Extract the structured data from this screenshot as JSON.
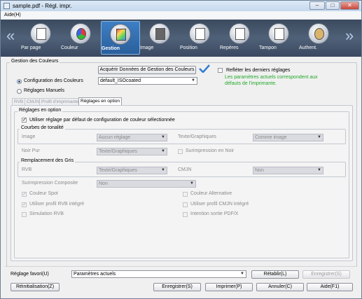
{
  "window": {
    "title": "sample.pdf - Régl. impr.",
    "buttons": {
      "minimize": "–",
      "maximize": "□",
      "close": "✕"
    }
  },
  "menu": {
    "help": "Aide(H)"
  },
  "toolbar": {
    "prev_arrow": "«",
    "next_arrow": "»",
    "items": [
      {
        "label": "Par page"
      },
      {
        "label": "Couleur"
      },
      {
        "label": "Gestion"
      },
      {
        "label": "Image"
      },
      {
        "label": "Position"
      },
      {
        "label": "Repères"
      },
      {
        "label": "Tampon"
      },
      {
        "label": "Authent."
      }
    ]
  },
  "color_mgmt": {
    "title": "Gestion des Couleurs",
    "acquire_button": "Acquérir Données de Gestion des Couleurs",
    "reflect_label": "Refléter les derniers réglages",
    "note_line1": "Les paramètres actuels correspondent aux",
    "note_line2": "défauts de l'imprimante.",
    "radio_config": "Configuration des Couleurs",
    "radio_manual": "Réglages Manuels",
    "config_value": "default_ISOcoated"
  },
  "tabs": [
    "RVB",
    "CMJN",
    "Profil d'imprimante",
    "Réglages en option"
  ],
  "options": {
    "title": "Réglages en option",
    "use_default": "Utiliser réglage par défaut de configuration de couleur sélectionnée",
    "tone_curves": {
      "title": "Courbes de tonalité",
      "image_label": "Image",
      "image_value": "Aucun réglage",
      "text_label": "Texte/Graphiques",
      "text_value": "Comme image"
    },
    "pure_black_label": "Noir Pur",
    "pure_black_value": "Texte/Graphiques",
    "overprint_black": "Surimpression en Noir",
    "gray": {
      "title": "Remplacement des Gris",
      "rgb_label": "RVB",
      "rgb_value": "Texte/Graphiques",
      "cmyk_label": "CMJN",
      "cmyk_value": "Non"
    },
    "composite_label": "Surimpression Composite",
    "composite_value": "Non",
    "spot_color": "Couleur Spot",
    "alt_color": "Couleur Alternative",
    "use_rgb_profile": "Utiliser profil RVB intégré",
    "use_cmyk_profile": "Utiliser profil CMJN intégré",
    "rgb_simulation": "Simulation RVB",
    "pdfx_intent": "Intention sortie PDF/X"
  },
  "footer": {
    "favorite_label": "Réglage favori(U)",
    "favorite_value": "Paramètres actuels",
    "restore": "Rétablir(L)",
    "save": "Enregistrer(S)",
    "reset": "Réinitialisation(Z)",
    "register": "Enregistrer(S)",
    "print": "Imprimer(P)",
    "cancel": "Annuler(C)",
    "help": "Aide(F1)"
  }
}
